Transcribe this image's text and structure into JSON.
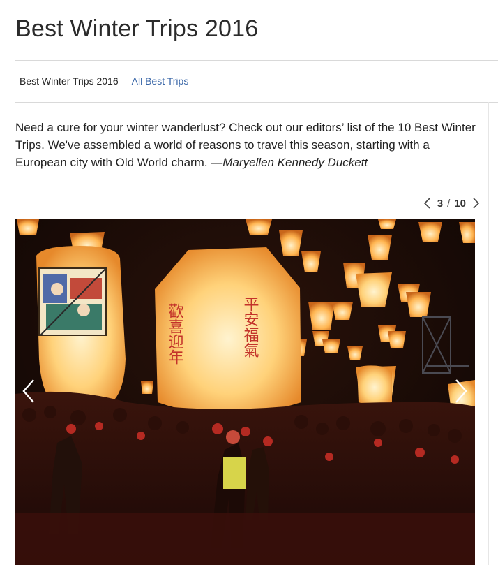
{
  "page": {
    "title": "Best Winter Trips 2016"
  },
  "breadcrumb": {
    "current": "Best Winter Trips 2016",
    "link": "All Best Trips"
  },
  "intro": {
    "text": "Need a cure for your winter wanderlust? Check out our editors’ list of the 10 Best Winter Trips. We've assembled a world of reasons to travel this season, starting with a European city with Old World charm. ",
    "byline": "—Maryellen Kennedy Duckett"
  },
  "gallery": {
    "current": "3",
    "separator": "/",
    "total": "10",
    "prev_icon": "chevron-left-icon",
    "next_icon": "chevron-right-icon",
    "photo_subject": "sky-lantern-festival-photo",
    "lantern_left_text": "歡喜迎年",
    "lantern_right_text": "平安福氣"
  },
  "colors": {
    "link": "#3a67a8",
    "rule": "#d9d9d9",
    "lantern_glow": "#ffb347"
  }
}
